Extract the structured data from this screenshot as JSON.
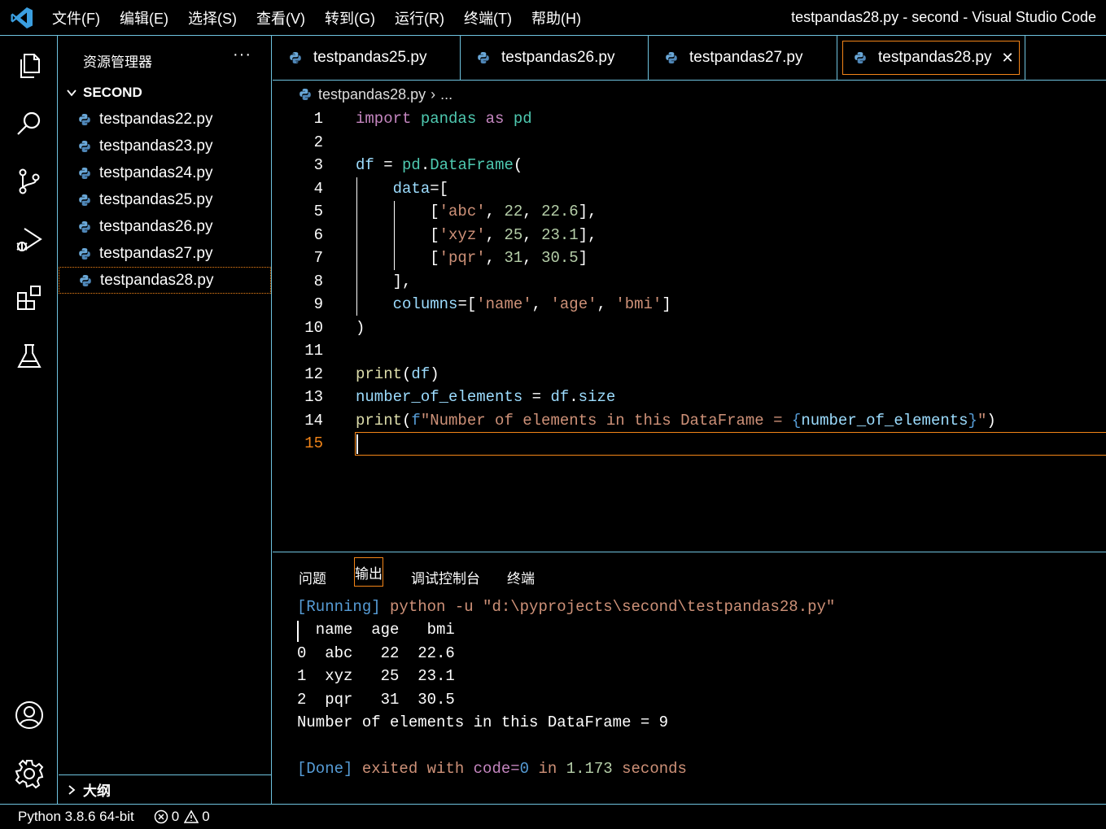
{
  "titlebar": {
    "menu": [
      "文件(F)",
      "编辑(E)",
      "选择(S)",
      "查看(V)",
      "转到(G)",
      "运行(R)",
      "终端(T)",
      "帮助(H)"
    ],
    "window_title": "testpandas28.py - second - Visual Studio Code"
  },
  "activity": [
    "explorer-icon",
    "search-icon",
    "source-control-icon",
    "run-debug-icon",
    "extensions-icon",
    "testing-icon",
    "account-icon",
    "settings-gear-icon"
  ],
  "sidebar": {
    "title": "资源管理器",
    "more": "···",
    "folder": "SECOND",
    "files": [
      "testpandas22.py",
      "testpandas23.py",
      "testpandas24.py",
      "testpandas25.py",
      "testpandas26.py",
      "testpandas27.py",
      "testpandas28.py"
    ],
    "outline": "大纲"
  },
  "tabs": [
    "testpandas25.py",
    "testpandas26.py",
    "testpandas27.py",
    "testpandas28.py"
  ],
  "active_tab_close": "✕",
  "breadcrumb": {
    "file": "testpandas28.py",
    "sep": "›",
    "rest": "..."
  },
  "editor": {
    "line_numbers": [
      "1",
      "2",
      "3",
      "4",
      "5",
      "6",
      "7",
      "8",
      "9",
      "10",
      "11",
      "12",
      "13",
      "14",
      "15"
    ],
    "current_line": "15"
  },
  "panel": {
    "tabs": [
      "问题",
      "输出",
      "调试控制台",
      "终端"
    ],
    "output": [
      "[Running] python -u \"d:\\pyprojects\\second\\testpandas28.py\"",
      "  name  age   bmi",
      "0  abc   22  22.6",
      "1  xyz   25  23.1",
      "2  pqr   31  30.5",
      "Number of elements in this DataFrame = 9",
      "",
      "[Done] exited with code=0 in 1.173 seconds"
    ]
  },
  "statusbar": {
    "python": "Python 3.8.6 64-bit",
    "errors": "0",
    "warnings": "0"
  },
  "colors": {
    "border": "#6fc3df",
    "focus": "#f38518",
    "background": "#000000"
  }
}
